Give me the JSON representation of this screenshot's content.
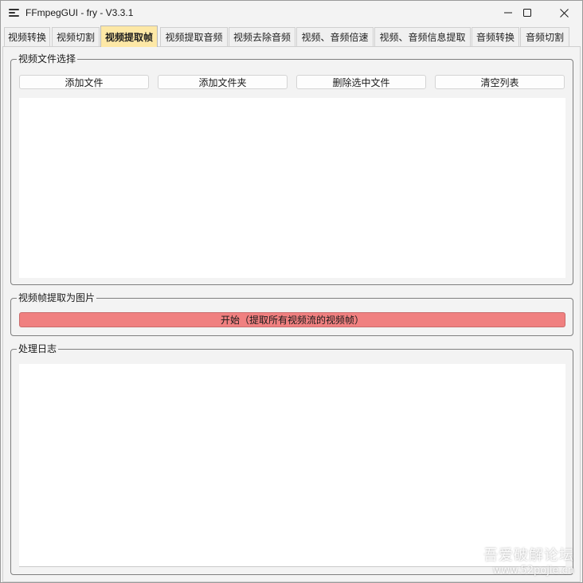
{
  "window": {
    "title": "FFmpegGUI - fry - V3.3.1"
  },
  "tabs": [
    {
      "label": "视频转换"
    },
    {
      "label": "视频切割"
    },
    {
      "label": "视频提取帧"
    },
    {
      "label": "视频提取音频"
    },
    {
      "label": "视频去除音频"
    },
    {
      "label": "视频、音频倍速"
    },
    {
      "label": "视频、音频信息提取"
    },
    {
      "label": "音频转换"
    },
    {
      "label": "音频切割"
    }
  ],
  "active_tab": "视频提取帧",
  "file_group": {
    "legend": "视频文件选择",
    "buttons": [
      {
        "label": "添加文件"
      },
      {
        "label": "添加文件夹"
      },
      {
        "label": "删除选中文件"
      },
      {
        "label": "清空列表"
      }
    ]
  },
  "extract_group": {
    "legend": "视频帧提取为图片",
    "start_label": "开始（提取所有视频流的视频帧）"
  },
  "log_group": {
    "legend": "处理日志"
  },
  "watermark": {
    "line1": "吾爱破解论坛",
    "line2": "www.52pojie.cn"
  },
  "colors": {
    "active_tab_bg": "#fde8a6",
    "start_button_bg": "#f08080"
  },
  "icons": {
    "app": "menu-lines-icon",
    "minimize": "minimize-icon",
    "maximize": "maximize-icon",
    "close": "close-icon"
  }
}
